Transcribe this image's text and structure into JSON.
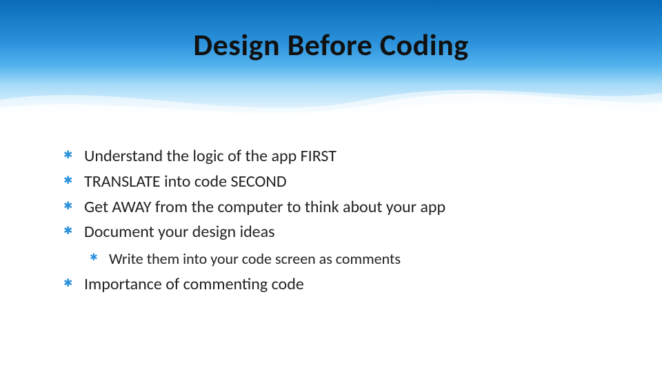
{
  "title": "Design Before Coding",
  "bullets": {
    "b1": "Understand the logic of the app FIRST",
    "b2": "TRANSLATE into code SECOND",
    "b3": "Get AWAY from the computer to think about your app",
    "b4": "Document your design ideas",
    "b4_1": "Write them into your code screen as comments",
    "b5": "Importance of commenting code"
  }
}
